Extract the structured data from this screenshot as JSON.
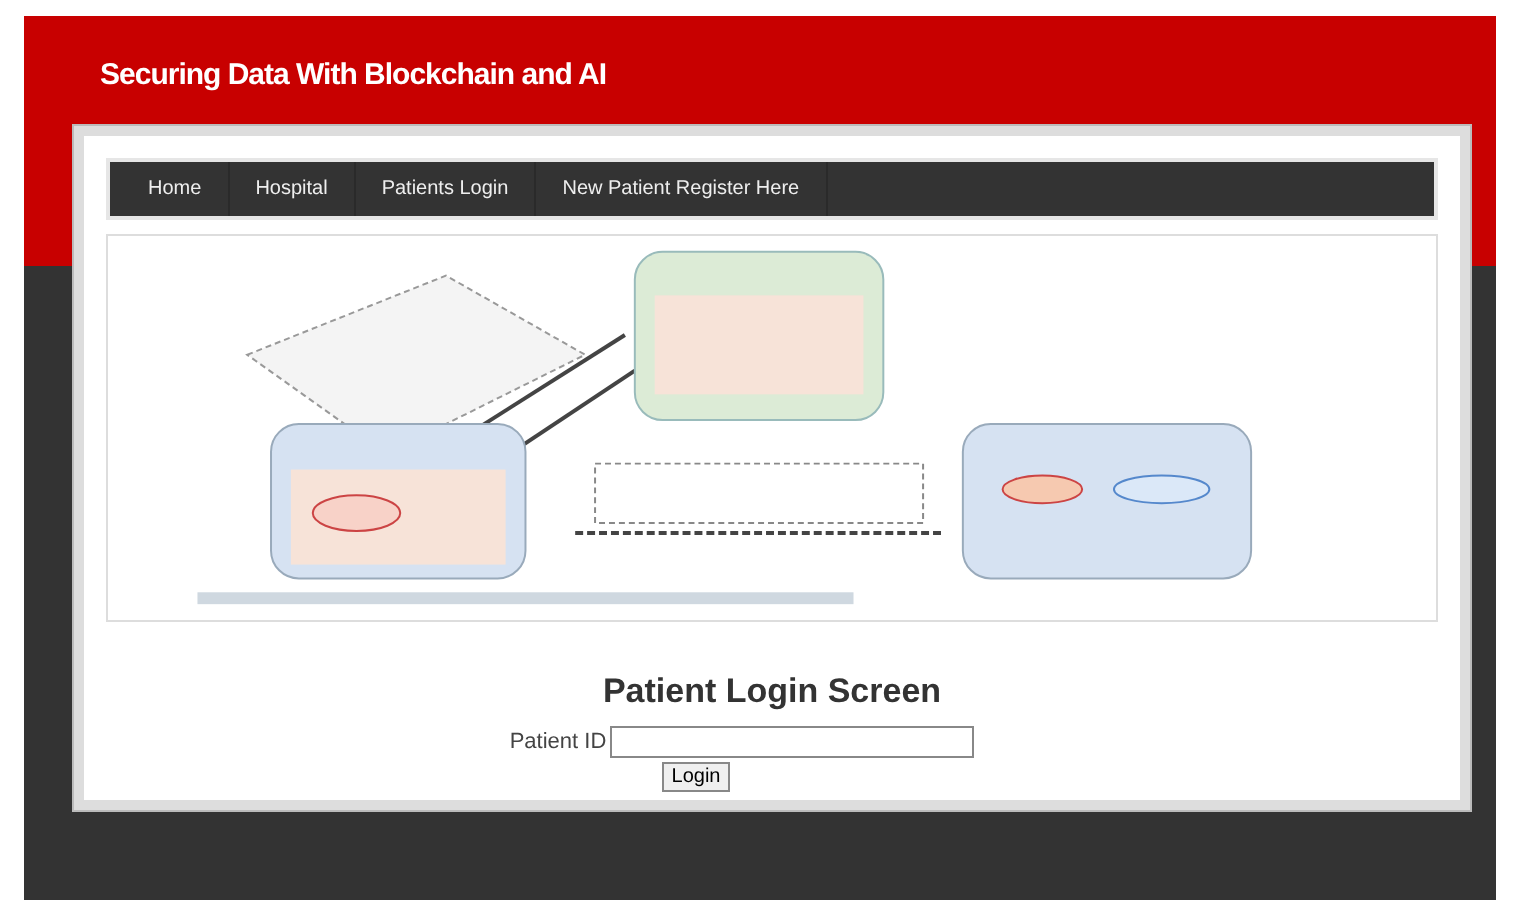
{
  "header": {
    "title": "Securing Data With Blockchain and AI"
  },
  "nav": [
    {
      "label": "Home"
    },
    {
      "label": "Hospital"
    },
    {
      "label": "Patients Login"
    },
    {
      "label": "New Patient Register Here"
    }
  ],
  "login": {
    "heading": "Patient Login Screen",
    "field_label": "Patient ID",
    "button": "Login"
  }
}
